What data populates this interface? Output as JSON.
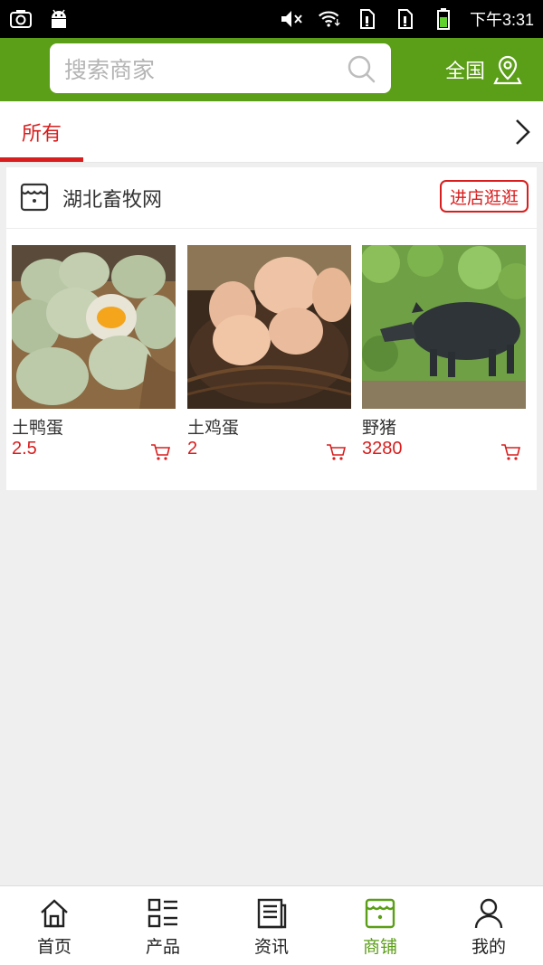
{
  "status_bar": {
    "time": "下午3:31",
    "left_icons": [
      "screenshot-icon",
      "android-icon"
    ],
    "right_icons": [
      "mute-icon",
      "wifi-icon",
      "sim1-icon",
      "sim2-icon",
      "battery-icon"
    ]
  },
  "header": {
    "search": {
      "placeholder": "搜索商家"
    },
    "region_label": "全国",
    "bg_color": "#5b9e17"
  },
  "tabs": {
    "items": [
      {
        "label": "所有",
        "active": true
      }
    ],
    "accent_color": "#d81e1e"
  },
  "shop": {
    "name": "湖北畜牧网",
    "enter_label": "进店逛逛",
    "products": [
      {
        "name": "土鸭蛋",
        "price": "2.5",
        "image": "duck-eggs-photo"
      },
      {
        "name": "土鸡蛋",
        "price": "2",
        "image": "chicken-eggs-photo"
      },
      {
        "name": "野猪",
        "price": "3280",
        "image": "wild-boar-photo"
      }
    ]
  },
  "bottom_nav": {
    "items": [
      {
        "label": "首页",
        "icon": "home-icon",
        "active": false
      },
      {
        "label": "产品",
        "icon": "list-icon",
        "active": false
      },
      {
        "label": "资讯",
        "icon": "news-icon",
        "active": false
      },
      {
        "label": "商铺",
        "icon": "store-icon",
        "active": true
      },
      {
        "label": "我的",
        "icon": "user-icon",
        "active": false
      }
    ]
  }
}
